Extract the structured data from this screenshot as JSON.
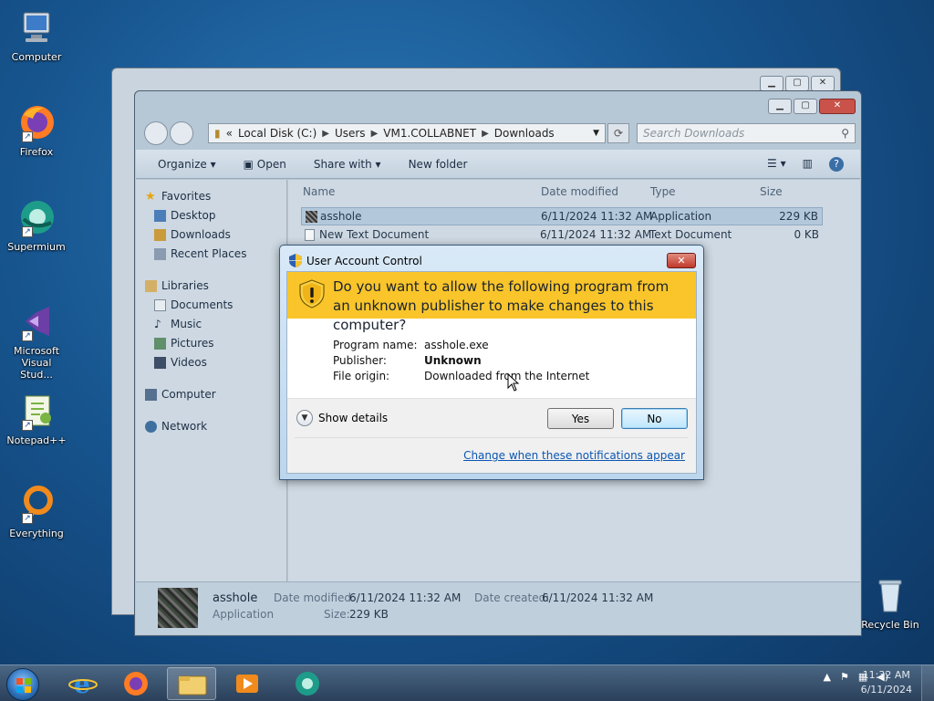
{
  "desktop": {
    "icons": [
      {
        "label": "Computer",
        "icon": "computer-icon"
      },
      {
        "label": "Firefox",
        "icon": "firefox-icon"
      },
      {
        "label": "Supermium",
        "icon": "supermium-icon"
      },
      {
        "label": "Microsoft Visual Stud...",
        "icon": "visual-studio-icon"
      },
      {
        "label": "Notepad++",
        "icon": "notepad-plus-plus-icon"
      },
      {
        "label": "Everything",
        "icon": "everything-icon"
      }
    ],
    "recycle_bin": "Recycle Bin"
  },
  "explorer": {
    "breadcrumb": [
      "Local Disk (C:)",
      "Users",
      "VM1.COLLABNET",
      "Downloads"
    ],
    "breadcrumb_prefix": "«",
    "search_placeholder": "Search Downloads",
    "toolbar": {
      "organize": "Organize ▾",
      "open": "Open",
      "share_with": "Share with ▾",
      "new_folder": "New folder"
    },
    "nav": {
      "favorites": "Favorites",
      "desktop": "Desktop",
      "downloads": "Downloads",
      "recent": "Recent Places",
      "libraries": "Libraries",
      "documents": "Documents",
      "music": "Music",
      "pictures": "Pictures",
      "videos": "Videos",
      "computer": "Computer",
      "network": "Network"
    },
    "columns": {
      "name": "Name",
      "date": "Date modified",
      "type": "Type",
      "size": "Size"
    },
    "files": [
      {
        "name": "asshole",
        "date": "6/11/2024 11:32 AM",
        "type": "Application",
        "size": "229 KB"
      },
      {
        "name": "New Text Document",
        "date": "6/11/2024 11:32 AM",
        "type": "Text Document",
        "size": "0 KB"
      }
    ],
    "details": {
      "name": "asshole",
      "kind": "Application",
      "date_modified_label": "Date modified:",
      "date_modified": "6/11/2024 11:32 AM",
      "size_label": "Size:",
      "size": "229 KB",
      "date_created_label": "Date created:",
      "date_created": "6/11/2024 11:32 AM"
    }
  },
  "uac": {
    "title": "User Account Control",
    "question": "Do you want to allow the following program from an unknown publisher to make changes to this computer?",
    "program_label": "Program name:",
    "program": "asshole.exe",
    "publisher_label": "Publisher:",
    "publisher": "Unknown",
    "origin_label": "File origin:",
    "origin": "Downloaded from the Internet",
    "show_details": "Show details",
    "yes": "Yes",
    "no": "No",
    "link": "Change when these notifications appear",
    "banner_color": "#f9c52a"
  },
  "taskbar": {
    "time": "11:32 AM",
    "date": "6/11/2024"
  }
}
